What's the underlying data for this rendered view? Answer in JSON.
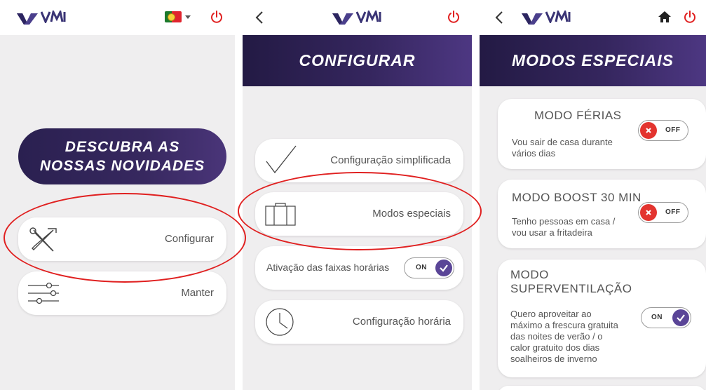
{
  "colors": {
    "brand_dark": "#231a44",
    "brand_purple": "#4d3782",
    "power_red": "#e02020",
    "toggle_off": "#e3342f",
    "toggle_on": "#5a4597",
    "highlight_ring": "#e02020"
  },
  "logo": {
    "text": "VMI",
    "icon": "vmi-logo-icon"
  },
  "screen1": {
    "language_flag": "portugal-flag-icon",
    "promo_line1": "DESCUBRA AS",
    "promo_line2": "NOSSAS NOVIDADES",
    "menu": [
      {
        "label": "Configurar",
        "icon": "tools-icon"
      },
      {
        "label": "Manter",
        "icon": "sliders-icon"
      }
    ]
  },
  "screen2": {
    "title": "CONFIGURAR",
    "items": [
      {
        "label": "Configuração simplificada",
        "icon": "checkmark-icon"
      },
      {
        "label": "Modos especiais",
        "icon": "suitcase-icon"
      },
      {
        "label": "Ativação das faixas horárias",
        "toggle": "ON"
      },
      {
        "label": "Configuração horária",
        "icon": "clock-icon"
      }
    ]
  },
  "screen3": {
    "title": "MODOS ESPECIAIS",
    "modes": [
      {
        "title": "MODO FÉRIAS",
        "desc_lines": [
          "Vou sair de casa durante",
          "vários dias"
        ],
        "toggle": "OFF"
      },
      {
        "title": "MODO BOOST 30 MIN",
        "desc_lines": [
          "Tenho pessoas em casa /",
          "vou usar a fritadeira"
        ],
        "toggle": "OFF"
      },
      {
        "title_lines": [
          "MODO",
          "SUPERVENTILAÇÃO"
        ],
        "desc_lines": [
          "Quero aproveitar ao",
          "máximo a frescura gratuita",
          "das noites de verão / o",
          "calor gratuito dos dias",
          "soalheiros de inverno"
        ],
        "toggle": "ON"
      }
    ]
  }
}
